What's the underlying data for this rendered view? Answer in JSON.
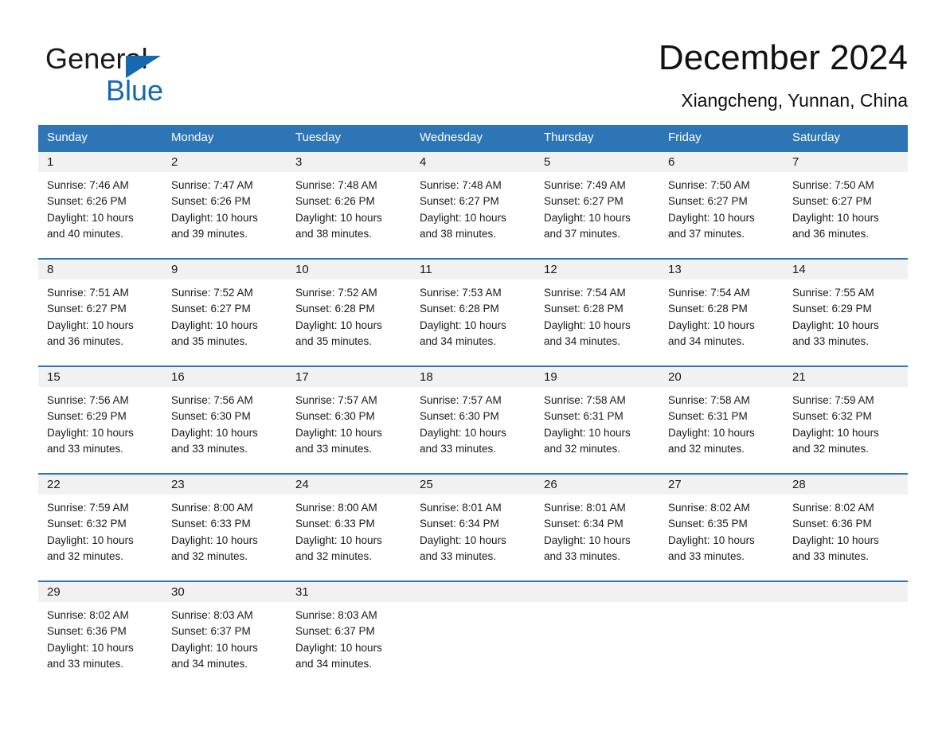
{
  "brand": {
    "name_part1": "General",
    "name_part2": "Blue",
    "triangle_icon": "blue-triangle-icon",
    "accent_color": "#1569b0"
  },
  "header": {
    "title": "December 2024",
    "subtitle": "Xiangcheng, Yunnan, China"
  },
  "theme": {
    "header_blue": "#2e75b6",
    "date_band_gray": "#f1f1f1",
    "text_color": "#1a1a1a"
  },
  "weekdays": [
    "Sunday",
    "Monday",
    "Tuesday",
    "Wednesday",
    "Thursday",
    "Friday",
    "Saturday"
  ],
  "weeks": [
    {
      "days": [
        {
          "number": "1",
          "sunrise": "Sunrise: 7:46 AM",
          "sunset": "Sunset: 6:26 PM",
          "daylight1": "Daylight: 10 hours",
          "daylight2": "and 40 minutes."
        },
        {
          "number": "2",
          "sunrise": "Sunrise: 7:47 AM",
          "sunset": "Sunset: 6:26 PM",
          "daylight1": "Daylight: 10 hours",
          "daylight2": "and 39 minutes."
        },
        {
          "number": "3",
          "sunrise": "Sunrise: 7:48 AM",
          "sunset": "Sunset: 6:26 PM",
          "daylight1": "Daylight: 10 hours",
          "daylight2": "and 38 minutes."
        },
        {
          "number": "4",
          "sunrise": "Sunrise: 7:48 AM",
          "sunset": "Sunset: 6:27 PM",
          "daylight1": "Daylight: 10 hours",
          "daylight2": "and 38 minutes."
        },
        {
          "number": "5",
          "sunrise": "Sunrise: 7:49 AM",
          "sunset": "Sunset: 6:27 PM",
          "daylight1": "Daylight: 10 hours",
          "daylight2": "and 37 minutes."
        },
        {
          "number": "6",
          "sunrise": "Sunrise: 7:50 AM",
          "sunset": "Sunset: 6:27 PM",
          "daylight1": "Daylight: 10 hours",
          "daylight2": "and 37 minutes."
        },
        {
          "number": "7",
          "sunrise": "Sunrise: 7:50 AM",
          "sunset": "Sunset: 6:27 PM",
          "daylight1": "Daylight: 10 hours",
          "daylight2": "and 36 minutes."
        }
      ]
    },
    {
      "days": [
        {
          "number": "8",
          "sunrise": "Sunrise: 7:51 AM",
          "sunset": "Sunset: 6:27 PM",
          "daylight1": "Daylight: 10 hours",
          "daylight2": "and 36 minutes."
        },
        {
          "number": "9",
          "sunrise": "Sunrise: 7:52 AM",
          "sunset": "Sunset: 6:27 PM",
          "daylight1": "Daylight: 10 hours",
          "daylight2": "and 35 minutes."
        },
        {
          "number": "10",
          "sunrise": "Sunrise: 7:52 AM",
          "sunset": "Sunset: 6:28 PM",
          "daylight1": "Daylight: 10 hours",
          "daylight2": "and 35 minutes."
        },
        {
          "number": "11",
          "sunrise": "Sunrise: 7:53 AM",
          "sunset": "Sunset: 6:28 PM",
          "daylight1": "Daylight: 10 hours",
          "daylight2": "and 34 minutes."
        },
        {
          "number": "12",
          "sunrise": "Sunrise: 7:54 AM",
          "sunset": "Sunset: 6:28 PM",
          "daylight1": "Daylight: 10 hours",
          "daylight2": "and 34 minutes."
        },
        {
          "number": "13",
          "sunrise": "Sunrise: 7:54 AM",
          "sunset": "Sunset: 6:28 PM",
          "daylight1": "Daylight: 10 hours",
          "daylight2": "and 34 minutes."
        },
        {
          "number": "14",
          "sunrise": "Sunrise: 7:55 AM",
          "sunset": "Sunset: 6:29 PM",
          "daylight1": "Daylight: 10 hours",
          "daylight2": "and 33 minutes."
        }
      ]
    },
    {
      "days": [
        {
          "number": "15",
          "sunrise": "Sunrise: 7:56 AM",
          "sunset": "Sunset: 6:29 PM",
          "daylight1": "Daylight: 10 hours",
          "daylight2": "and 33 minutes."
        },
        {
          "number": "16",
          "sunrise": "Sunrise: 7:56 AM",
          "sunset": "Sunset: 6:30 PM",
          "daylight1": "Daylight: 10 hours",
          "daylight2": "and 33 minutes."
        },
        {
          "number": "17",
          "sunrise": "Sunrise: 7:57 AM",
          "sunset": "Sunset: 6:30 PM",
          "daylight1": "Daylight: 10 hours",
          "daylight2": "and 33 minutes."
        },
        {
          "number": "18",
          "sunrise": "Sunrise: 7:57 AM",
          "sunset": "Sunset: 6:30 PM",
          "daylight1": "Daylight: 10 hours",
          "daylight2": "and 33 minutes."
        },
        {
          "number": "19",
          "sunrise": "Sunrise: 7:58 AM",
          "sunset": "Sunset: 6:31 PM",
          "daylight1": "Daylight: 10 hours",
          "daylight2": "and 32 minutes."
        },
        {
          "number": "20",
          "sunrise": "Sunrise: 7:58 AM",
          "sunset": "Sunset: 6:31 PM",
          "daylight1": "Daylight: 10 hours",
          "daylight2": "and 32 minutes."
        },
        {
          "number": "21",
          "sunrise": "Sunrise: 7:59 AM",
          "sunset": "Sunset: 6:32 PM",
          "daylight1": "Daylight: 10 hours",
          "daylight2": "and 32 minutes."
        }
      ]
    },
    {
      "days": [
        {
          "number": "22",
          "sunrise": "Sunrise: 7:59 AM",
          "sunset": "Sunset: 6:32 PM",
          "daylight1": "Daylight: 10 hours",
          "daylight2": "and 32 minutes."
        },
        {
          "number": "23",
          "sunrise": "Sunrise: 8:00 AM",
          "sunset": "Sunset: 6:33 PM",
          "daylight1": "Daylight: 10 hours",
          "daylight2": "and 32 minutes."
        },
        {
          "number": "24",
          "sunrise": "Sunrise: 8:00 AM",
          "sunset": "Sunset: 6:33 PM",
          "daylight1": "Daylight: 10 hours",
          "daylight2": "and 32 minutes."
        },
        {
          "number": "25",
          "sunrise": "Sunrise: 8:01 AM",
          "sunset": "Sunset: 6:34 PM",
          "daylight1": "Daylight: 10 hours",
          "daylight2": "and 33 minutes."
        },
        {
          "number": "26",
          "sunrise": "Sunrise: 8:01 AM",
          "sunset": "Sunset: 6:34 PM",
          "daylight1": "Daylight: 10 hours",
          "daylight2": "and 33 minutes."
        },
        {
          "number": "27",
          "sunrise": "Sunrise: 8:02 AM",
          "sunset": "Sunset: 6:35 PM",
          "daylight1": "Daylight: 10 hours",
          "daylight2": "and 33 minutes."
        },
        {
          "number": "28",
          "sunrise": "Sunrise: 8:02 AM",
          "sunset": "Sunset: 6:36 PM",
          "daylight1": "Daylight: 10 hours",
          "daylight2": "and 33 minutes."
        }
      ]
    },
    {
      "days": [
        {
          "number": "29",
          "sunrise": "Sunrise: 8:02 AM",
          "sunset": "Sunset: 6:36 PM",
          "daylight1": "Daylight: 10 hours",
          "daylight2": "and 33 minutes."
        },
        {
          "number": "30",
          "sunrise": "Sunrise: 8:03 AM",
          "sunset": "Sunset: 6:37 PM",
          "daylight1": "Daylight: 10 hours",
          "daylight2": "and 34 minutes."
        },
        {
          "number": "31",
          "sunrise": "Sunrise: 8:03 AM",
          "sunset": "Sunset: 6:37 PM",
          "daylight1": "Daylight: 10 hours",
          "daylight2": "and 34 minutes."
        },
        {
          "number": "",
          "sunrise": "",
          "sunset": "",
          "daylight1": "",
          "daylight2": ""
        },
        {
          "number": "",
          "sunrise": "",
          "sunset": "",
          "daylight1": "",
          "daylight2": ""
        },
        {
          "number": "",
          "sunrise": "",
          "sunset": "",
          "daylight1": "",
          "daylight2": ""
        },
        {
          "number": "",
          "sunrise": "",
          "sunset": "",
          "daylight1": "",
          "daylight2": ""
        }
      ]
    }
  ]
}
